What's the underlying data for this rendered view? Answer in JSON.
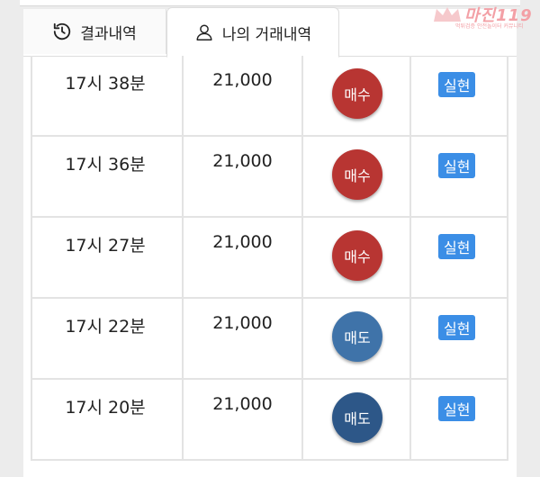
{
  "tabs": [
    {
      "label": "결과내역",
      "icon": "history-icon"
    },
    {
      "label": "나의 거래내역",
      "icon": "user-icon"
    }
  ],
  "logo": {
    "name": "마진",
    "suffix": "119",
    "tagline": "먹튀검증 안전놀이터 커뮤니티"
  },
  "colors": {
    "buy": "#b83532",
    "sell_light": "#3f73a9",
    "sell_dark": "#2d5788",
    "badge": "#3b8ee6"
  },
  "rows": [
    {
      "time": "17시 38분",
      "price": "21,000",
      "side": "매수",
      "side_type": "buy",
      "status": "실현"
    },
    {
      "time": "17시 36분",
      "price": "21,000",
      "side": "매수",
      "side_type": "buy",
      "status": "실현"
    },
    {
      "time": "17시 27분",
      "price": "21,000",
      "side": "매수",
      "side_type": "buy",
      "status": "실현"
    },
    {
      "time": "17시 22분",
      "price": "21,000",
      "side": "매도",
      "side_type": "sell",
      "status": "실현"
    },
    {
      "time": "17시 20분",
      "price": "21,000",
      "side": "매도",
      "side_type": "sell",
      "status": "실현"
    }
  ]
}
